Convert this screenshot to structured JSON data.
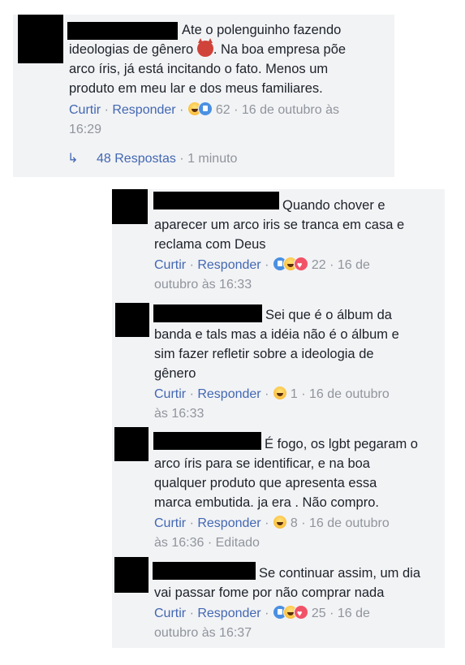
{
  "actions": {
    "like": "Curtir",
    "reply": "Responder",
    "dot": "·"
  },
  "main": {
    "text_lines": [
      "Ate o polenguinho fazendo",
      "ideologias de gênero",
      ". Na boa empresa põe",
      "arco íris, já está incitando o fato. Menos um",
      "produto em meu lar e dos meus familiares."
    ],
    "reactions": [
      "haha",
      "like"
    ],
    "reaction_count": "62",
    "date_part1": "16 de outubro às",
    "date_part2": "16:29",
    "replies_link": "48 Respostas",
    "replies_time": "1 minuto"
  },
  "replies": [
    {
      "lines": [
        "Quando chover e",
        "aparecer um arco iris se tranca em casa e",
        "reclama com Deus"
      ],
      "reactions": [
        "like",
        "haha",
        "angry"
      ],
      "count": "22",
      "date_a": "16 de",
      "date_b": "outubro às 16:33",
      "edited": ""
    },
    {
      "lines": [
        "Sei que é o álbum da",
        "banda e tals mas a idéia não é o álbum e",
        "sim fazer refletir sobre a ideologia de",
        "gênero"
      ],
      "reactions": [
        "haha"
      ],
      "count": "1",
      "date_a": "16 de outubro",
      "date_b": "às 16:33",
      "edited": ""
    },
    {
      "lines": [
        "É fogo, os lgbt pegaram o",
        "arco íris para se identificar, e na boa",
        "qualquer produto que apresenta essa",
        "marca embutida. ja era . Não compro."
      ],
      "reactions": [
        "haha"
      ],
      "count": "8",
      "date_a": "16 de outubro",
      "date_b": "às 16:36",
      "edited": "Editado"
    },
    {
      "lines": [
        "Se continuar assim, um dia",
        "vai passar fome por não comprar nada"
      ],
      "reactions": [
        "like",
        "haha",
        "angry"
      ],
      "count": "25",
      "date_a": "16 de",
      "date_b": "outubro às 16:37",
      "edited": ""
    }
  ]
}
